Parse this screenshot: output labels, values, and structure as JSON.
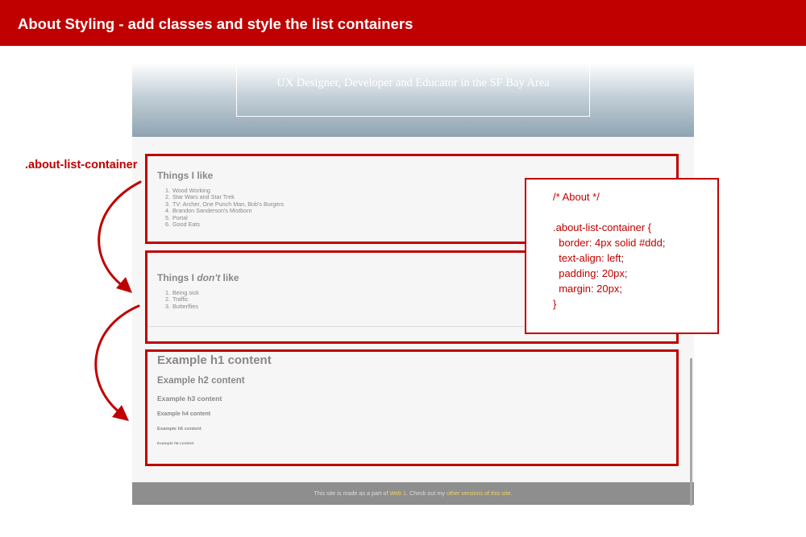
{
  "header": {
    "title": "About Styling - add classes and style the list containers"
  },
  "hero": {
    "tagline": "UX Designer, Developer and Educator in the SF Bay Area"
  },
  "callout": {
    "label": ".about-list-container"
  },
  "likes": {
    "heading": "Things I like",
    "items": [
      "Wood Working",
      "Star Wars and Star Trek",
      "TV: Archer, One Punch Man, Bob's Burgers",
      "Brandon Sanderson's Mistborn",
      "Portal",
      "Good Eats"
    ]
  },
  "dislikes": {
    "heading_pre": "Things I ",
    "heading_em": "don't",
    "heading_post": " like",
    "items": [
      "Being sick",
      "Traffic",
      "Butterflies"
    ]
  },
  "headings": {
    "h1": "Example h1 content",
    "h2": "Example h2 content",
    "h3": "Example h3 content",
    "h4": "Example h4 content",
    "h5": "Example h5 content",
    "h6": "Example h6 content"
  },
  "code": {
    "lines": [
      "/* About */",
      "",
      ".about-list-container {",
      "  border: 4px solid #ddd;",
      "  text-align: left;",
      "  padding: 20px;",
      "  margin: 20px;",
      "}"
    ]
  },
  "footer": {
    "text_pre": "This site is made as a part of ",
    "link1": "Web 1",
    "text_mid": ". Check out my ",
    "link2": "other versions of this site",
    "text_post": "."
  },
  "colors": {
    "accent": "#c00000",
    "footer_link": "#f0d25a"
  },
  "icons": [
    "curved-arrow-icon",
    "curved-arrow-icon"
  ]
}
